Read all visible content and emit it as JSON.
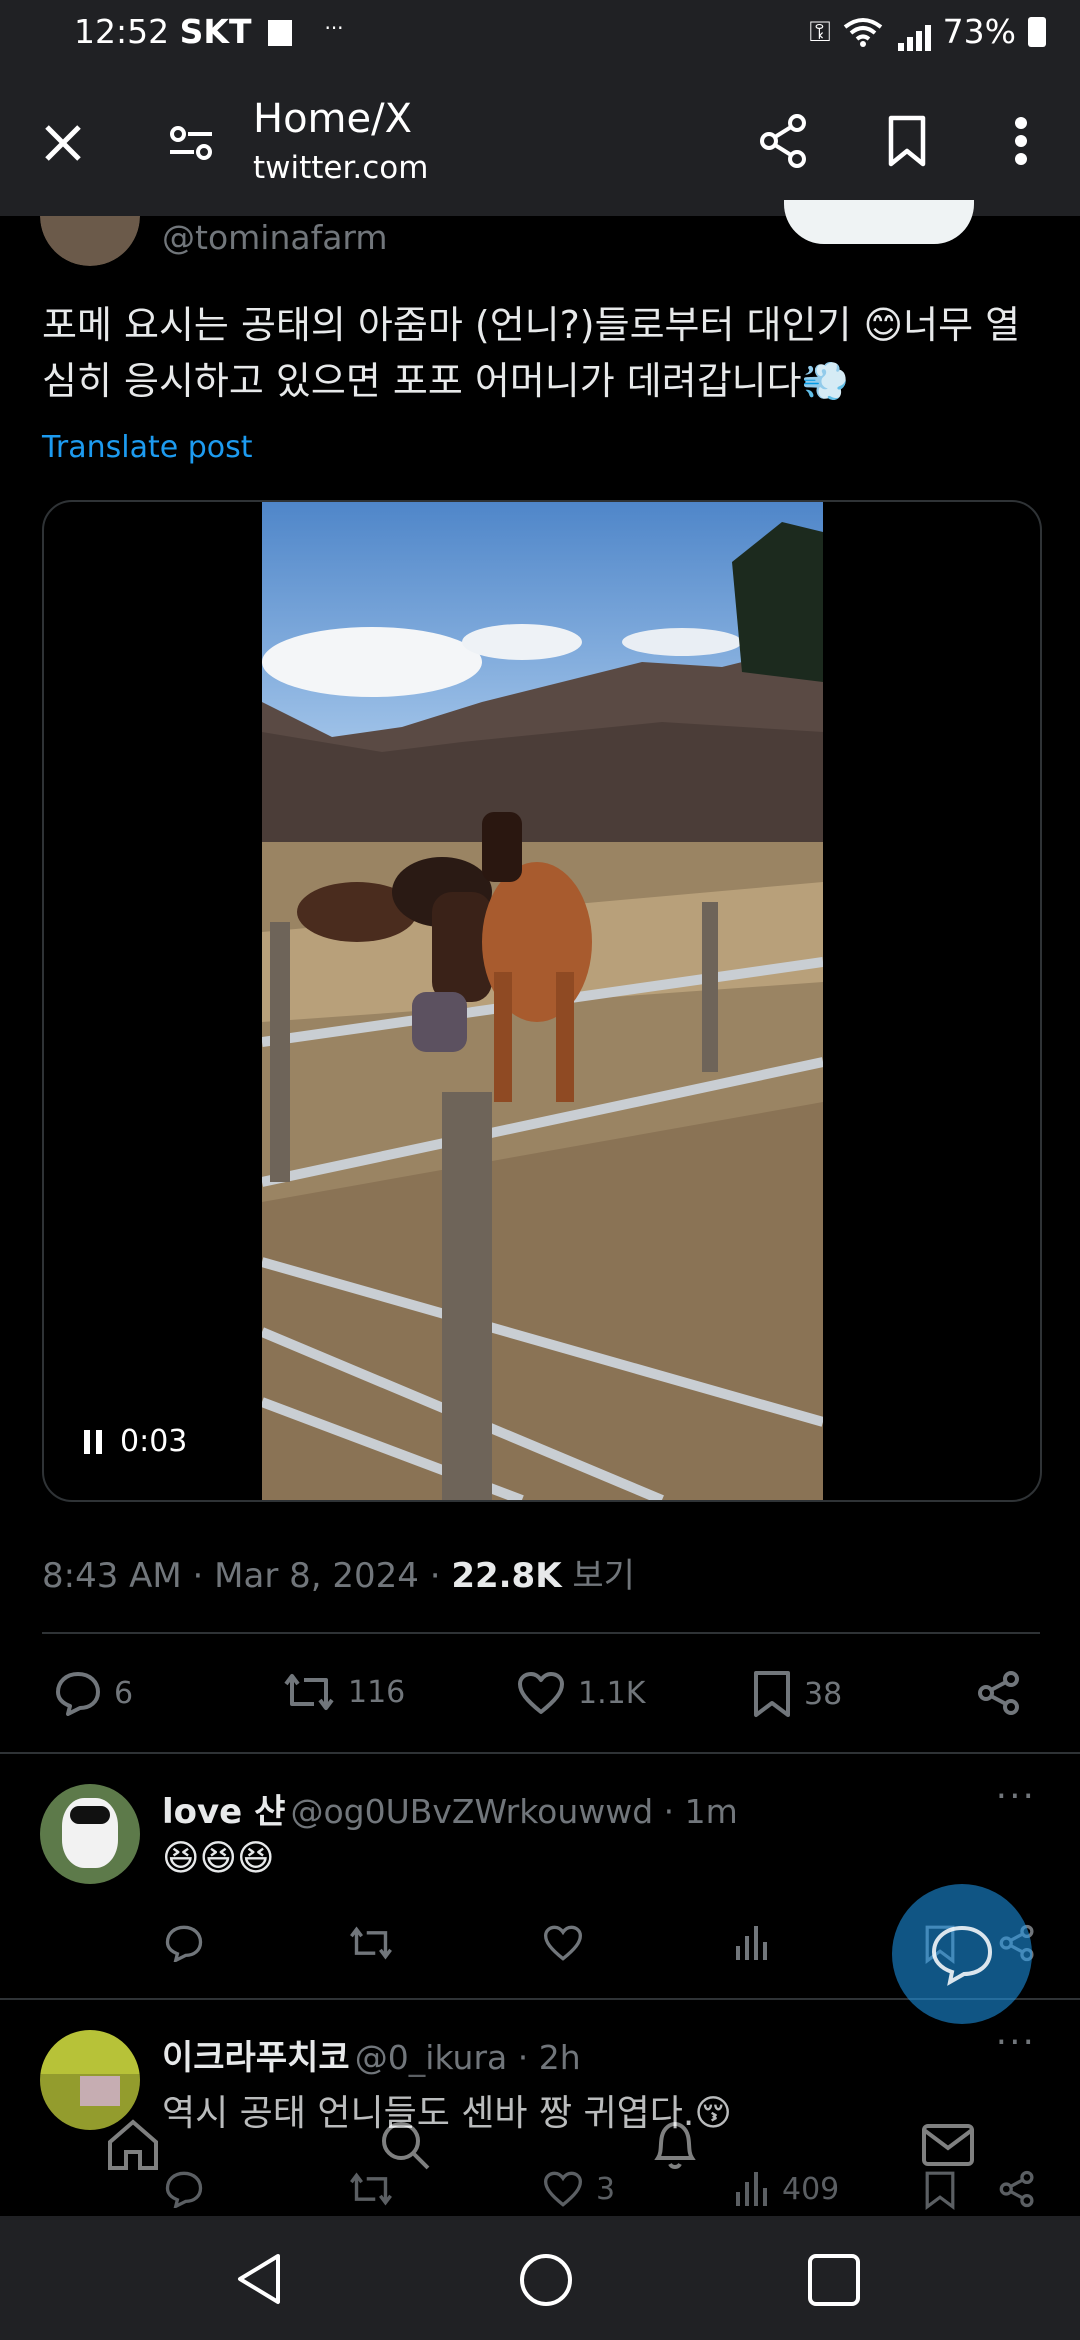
{
  "status_bar": {
    "time": "12:52",
    "carrier": "SKT",
    "battery": "73%"
  },
  "browser": {
    "title": "Home/X",
    "url": "twitter.com"
  },
  "post": {
    "handle": "@tominafarm",
    "text": "포메 요시는 공태의 아줌마 (언니?)들로부터 대인기 😊너무 열심히 응시하고 있으면 포포 어머니가 데려갑니다💨",
    "translate_label": "Translate post",
    "video_time": "0:03",
    "timestamp": "8:43 AM · Mar 8, 2024 · ",
    "views_count": "22.8K",
    "views_label": " 보기",
    "stats": {
      "replies": "6",
      "reposts": "116",
      "likes": "1.1K",
      "bookmarks": "38"
    }
  },
  "replies": [
    {
      "name": "love 샨",
      "handle": "@og0UBvZWrkouwwd · 1m",
      "text": "😆😆😆",
      "likes": "",
      "views": ""
    },
    {
      "name": "이크라푸치코",
      "handle": "@0_ikura · 2h",
      "text": "역시 공태 언니들도 센바 짱 귀엽다.😚",
      "likes": "3",
      "views": "409"
    }
  ]
}
